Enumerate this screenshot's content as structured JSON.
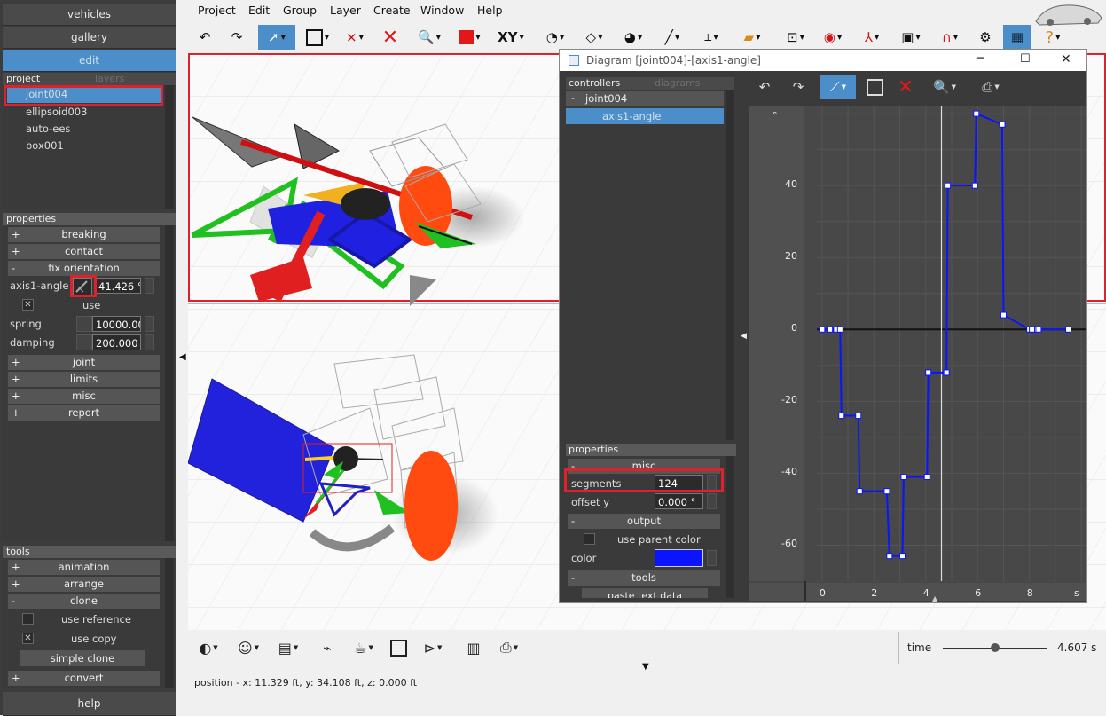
{
  "nav": {
    "vehicles": "vehicles",
    "gallery": "gallery",
    "edit": "edit",
    "help": "help"
  },
  "project": {
    "tab_project": "project",
    "tab_layers": "layers",
    "items": [
      "joint004",
      "ellipsoid003",
      "auto-ees",
      "box001"
    ]
  },
  "properties": {
    "header": "properties",
    "breaking": "breaking",
    "contact": "contact",
    "fix_orientation": "fix orientation",
    "axis1_label": "axis1-angle",
    "axis1_value": "41.426 °",
    "use_label": "use",
    "spring_label": "spring",
    "spring_value": "10000.000",
    "damping_label": "damping",
    "damping_value": "200.000 N",
    "joint": "joint",
    "limits": "limits",
    "misc": "misc",
    "report": "report",
    "plus": "+",
    "minus": "-",
    "check": "✕"
  },
  "tools": {
    "header": "tools",
    "animation": "animation",
    "arrange": "arrange",
    "clone": "clone",
    "use_reference": "use reference",
    "use_copy": "use copy",
    "simple_clone": "simple clone",
    "convert": "convert"
  },
  "menu": [
    "Project",
    "Edit",
    "Group",
    "Layer",
    "Create",
    "Window",
    "Help"
  ],
  "toolbar": {
    "xy": "XY"
  },
  "diagram": {
    "title": "Diagram [joint004]-[axis1-angle]",
    "tab_controllers": "controllers",
    "tab_diagrams": "diagrams",
    "tree_root": "joint004",
    "tree_child": "axis1-angle",
    "tree_minus": "-",
    "properties_header": "properties",
    "misc": "misc",
    "segments_label": "segments",
    "segments_value": "124",
    "offset_label": "offset y",
    "offset_value": "0.000 °",
    "output": "output",
    "use_parent_color": "use parent color",
    "color_label": "color",
    "tools": "tools",
    "paste_text": "paste text data",
    "unit_y": "°",
    "unit_x": "s",
    "y_ticks": [
      "40",
      "20",
      "0",
      "-20",
      "-40",
      "-60"
    ],
    "x_ticks": [
      "0",
      "2",
      "4",
      "6",
      "8"
    ],
    "curve_color": "#0a14ff"
  },
  "status": {
    "position": "position - x: 11.329 ft, y: 34.108 ft, z: 0.000 ft",
    "time_label": "time",
    "time_value": "4.607 s",
    "time_fraction": 0.5
  },
  "chart_data": {
    "type": "line",
    "x": [
      0,
      0.3,
      0.55,
      0.7,
      0.75,
      1.4,
      1.45,
      2.5,
      2.6,
      3.1,
      3.15,
      4.05,
      4.1,
      4.8,
      4.85,
      5.9,
      5.95,
      6.95,
      7.0,
      8.0,
      8.1,
      8.3,
      8.35,
      9.5
    ],
    "y": [
      0,
      0,
      0,
      0,
      -24,
      -24,
      -45,
      -45,
      -63,
      -63,
      -41,
      -41,
      -12,
      -12,
      40,
      40,
      60,
      57,
      4,
      0,
      0,
      0,
      0,
      0
    ],
    "xlim": [
      -0.2,
      10.2
    ],
    "ylim": [
      -70,
      62
    ],
    "xlabel": "s",
    "ylabel": "°",
    "grid": true,
    "legend": "none"
  }
}
